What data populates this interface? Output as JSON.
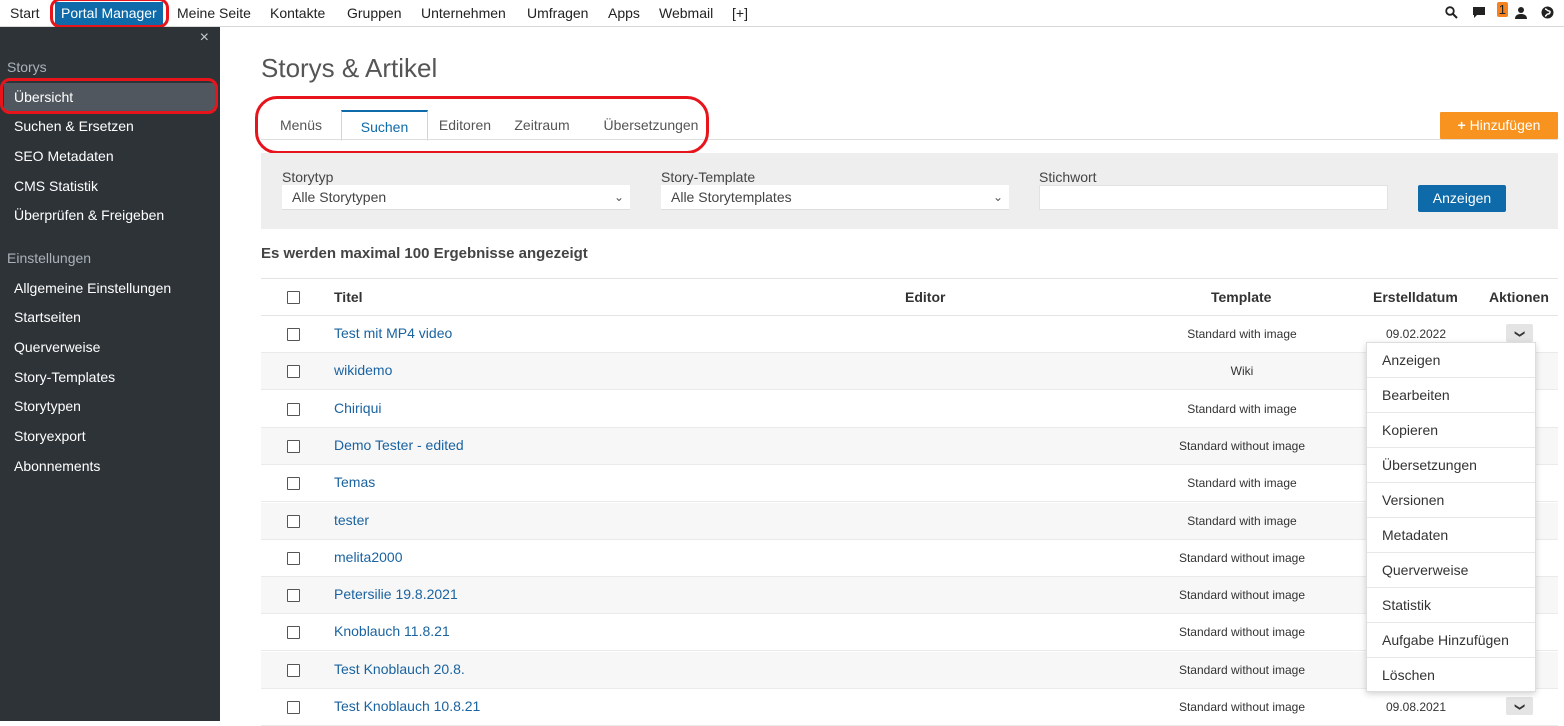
{
  "topnav": {
    "items": [
      "Start",
      "Portal Manager",
      "Meine Seite",
      "Kontakte",
      "Gruppen",
      "Unternehmen",
      "Umfragen",
      "Apps",
      "Webmail",
      "[+]"
    ],
    "badge": "1",
    "icons": [
      "search-icon",
      "chat-icon",
      "user-icon",
      "globe-icon"
    ]
  },
  "sidebar": {
    "close": "×",
    "section1": "Storys",
    "items1": [
      "Übersicht",
      "Suchen & Ersetzen",
      "SEO Metadaten",
      "CMS Statistik",
      "Überprüfen & Freigeben"
    ],
    "section2": "Einstellungen",
    "items2": [
      "Allgemeine Einstellungen",
      "Startseiten",
      "Querverweise",
      "Story-Templates",
      "Storytypen",
      "Storyexport",
      "Abonnements"
    ]
  },
  "main": {
    "title": "Storys & Artikel",
    "tabs": [
      "Menüs",
      "Suchen",
      "Editoren",
      "Zeitraum",
      "Übersetzungen"
    ],
    "add_button": "Hinzufügen",
    "filters": {
      "storytyp_label": "Storytyp",
      "storytyp_value": "Alle Storytypen",
      "template_label": "Story-Template",
      "template_value": "Alle Storytemplates",
      "stichwort_label": "Stichwort",
      "show_button": "Anzeigen"
    },
    "result_note": "Es werden maximal 100 Ergebnisse angezeigt"
  },
  "table": {
    "headers": {
      "titel": "Titel",
      "editor": "Editor",
      "template": "Template",
      "erstelldatum": "Erstelldatum",
      "aktionen": "Aktionen"
    },
    "rows": [
      {
        "title": "Test mit MP4 video",
        "template": "Standard with image",
        "date": "09.02.2022"
      },
      {
        "title": "wikidemo",
        "template": "Wiki",
        "date": ""
      },
      {
        "title": "Chiriqui",
        "template": "Standard with image",
        "date": ""
      },
      {
        "title": "Demo Tester - edited",
        "template": "Standard without image",
        "date": ""
      },
      {
        "title": "Temas",
        "template": "Standard with image",
        "date": ""
      },
      {
        "title": "tester",
        "template": "Standard with image",
        "date": ""
      },
      {
        "title": "melita2000",
        "template": "Standard without image",
        "date": ""
      },
      {
        "title": "Petersilie 19.8.2021",
        "template": "Standard without image",
        "date": ""
      },
      {
        "title": "Knoblauch 11.8.21",
        "template": "Standard without image",
        "date": ""
      },
      {
        "title": "Test Knoblauch 20.8.",
        "template": "Standard without image",
        "date": ""
      },
      {
        "title": "Test Knoblauch 10.8.21",
        "template": "Standard without image",
        "date": "09.08.2021"
      }
    ]
  },
  "action_menu": [
    "Anzeigen",
    "Bearbeiten",
    "Kopieren",
    "Übersetzungen",
    "Versionen",
    "Metadaten",
    "Querverweise",
    "Statistik",
    "Aufgabe Hinzufügen",
    "Löschen"
  ],
  "colors": {
    "accent": "#0e6aa8",
    "orange": "#f7931e",
    "sidebar": "#2e3338",
    "highlight": "#e8141c"
  }
}
